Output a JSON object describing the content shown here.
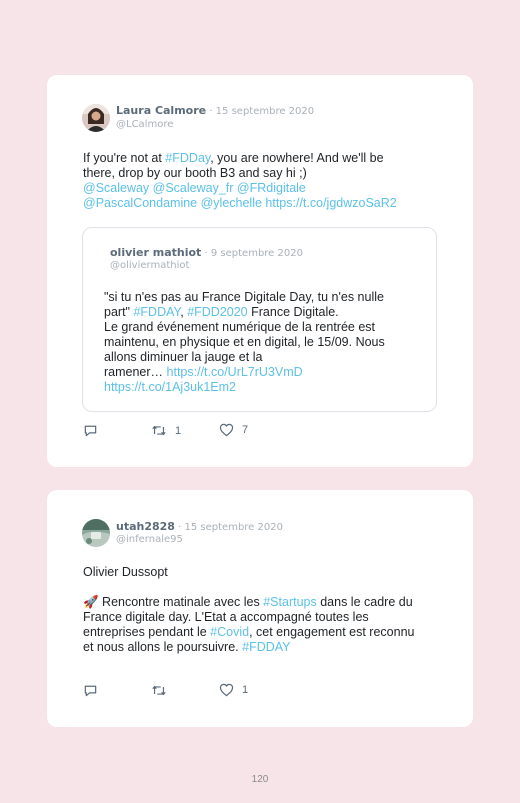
{
  "tweets": [
    {
      "name": "Laura Calmore",
      "date": "15 septembre 2020",
      "handle": "@LCalmore",
      "lines": [
        [
          "If you're not at ",
          "#FDDay",
          ", you are nowhere! And we'll be"
        ],
        [
          "there, drop by our booth B3 and say hi ;)"
        ],
        [
          "@Scaleway @Scaleway_fr @FRdigitale"
        ],
        [
          "@PascalCondamine @ylechelle https://t.co/jgdwzoSaR2"
        ]
      ],
      "quoted": {
        "name": "olivier mathiot",
        "date": "9 septembre 2020",
        "handle": "@oliviermathiot",
        "lines": [
          [
            "\"si tu n'es pas au France Digitale Day, tu n'es nulle"
          ],
          [
            "part\" ",
            "#FDDAY",
            ", ",
            "#FDD2020",
            " France Digitale."
          ],
          [
            "Le grand événement numérique de la rentrée est"
          ],
          [
            "maintenu, en physique et en digital, le 15/09. Nous"
          ],
          [
            "allons diminuer la jauge et la"
          ],
          [
            "ramener… ",
            "https://t.co/UrL7rU3VmD"
          ],
          [
            "https://t.co/1Aj3uk1Em2"
          ]
        ]
      },
      "retweets": "1",
      "likes": "7"
    },
    {
      "name": "utah2828",
      "date": "15 septembre 2020",
      "handle": "@infernale95",
      "lines": [
        [
          "Olivier Dussopt"
        ],
        [
          ""
        ],
        [
          "🚀 Rencontre matinale avec les ",
          "#Startups",
          " dans le cadre du"
        ],
        [
          "France digitale day. L'Etat a accompagné toutes les"
        ],
        [
          "entreprises pendant le ",
          "#Covid",
          ", cet engagement est reconnu"
        ],
        [
          "et nous allons le poursuivre. ",
          "#FDDAY"
        ]
      ],
      "retweets": "",
      "likes": "1"
    }
  ],
  "page_number": "120",
  "colors": {
    "background": "#f7e4e8",
    "link": "#5cc0e8",
    "text": "#1f2327",
    "meta": "#a9b1b8"
  },
  "icons": [
    "reply-icon",
    "retweet-icon",
    "like-icon"
  ]
}
